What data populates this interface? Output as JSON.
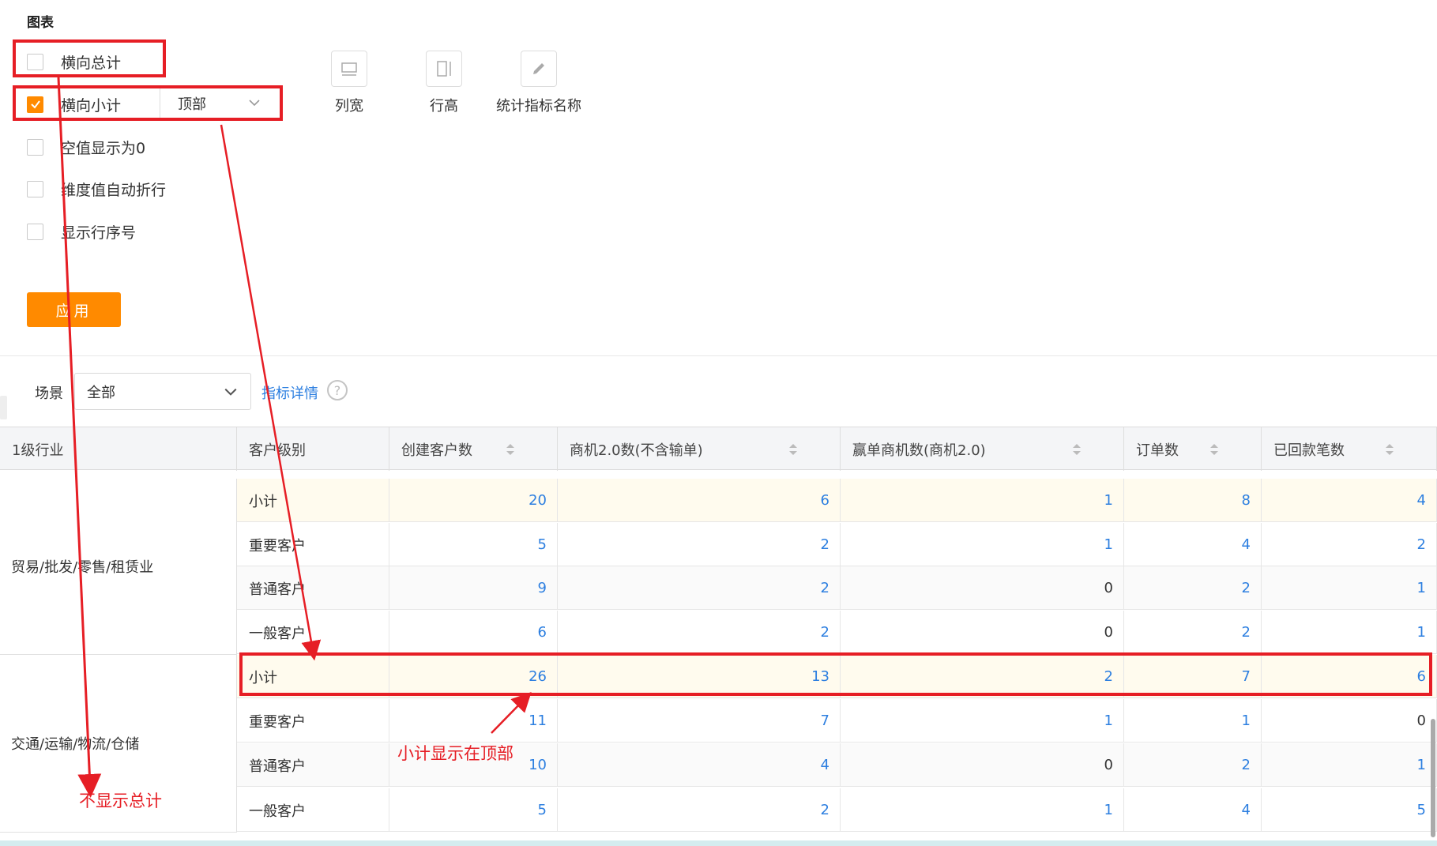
{
  "section_title": "图表",
  "options": [
    {
      "label": "横向总计",
      "checked": false
    },
    {
      "label": "横向小计",
      "checked": true
    },
    {
      "label": "空值显示为0",
      "checked": false
    },
    {
      "label": "维度值自动折行",
      "checked": false
    },
    {
      "label": "显示行序号",
      "checked": false
    }
  ],
  "subtotal_position": "顶部",
  "tools": [
    {
      "label": "列宽",
      "icon": "column-width-icon"
    },
    {
      "label": "行高",
      "icon": "row-height-icon"
    },
    {
      "label": "统计指标名称",
      "icon": "pencil-icon"
    }
  ],
  "apply_label": "应用",
  "scene_label": "场景",
  "scene_value": "全部",
  "detail_link": "指标详情",
  "help_icon": "?",
  "table": {
    "headers": [
      "1级行业",
      "客户级别",
      "创建客户数",
      "商机2.0数(不含输单)",
      "赢单商机数(商机2.0)",
      "订单数",
      "已回款笔数"
    ],
    "groups": [
      {
        "name": "贸易/批发/零售/租赁业"
      },
      {
        "name": "交通/运输/物流/仓储"
      }
    ],
    "rows": [
      {
        "label": "小计",
        "values": [
          "20",
          "6",
          "1",
          "8",
          "4"
        ]
      },
      {
        "label": "重要客户",
        "values": [
          "5",
          "2",
          "1",
          "4",
          "2"
        ]
      },
      {
        "label": "普通客户",
        "values": [
          "9",
          "2",
          "0",
          "2",
          "1"
        ]
      },
      {
        "label": "一般客户",
        "values": [
          "6",
          "2",
          "0",
          "2",
          "1"
        ]
      },
      {
        "label": "小计",
        "values": [
          "26",
          "13",
          "2",
          "7",
          "6"
        ]
      },
      {
        "label": "重要客户",
        "values": [
          "11",
          "7",
          "1",
          "1",
          "0"
        ]
      },
      {
        "label": "普通客户",
        "values": [
          "10",
          "4",
          "0",
          "2",
          "1"
        ]
      },
      {
        "label": "一般客户",
        "values": [
          "5",
          "2",
          "1",
          "4",
          "5"
        ]
      }
    ]
  },
  "annotations": {
    "no_total": "不显示总计",
    "subtotal_top": "小计显示在顶部"
  },
  "colors": {
    "accent": "#ff8a00",
    "link": "#2d7fe0",
    "annotation": "#e61e25"
  }
}
